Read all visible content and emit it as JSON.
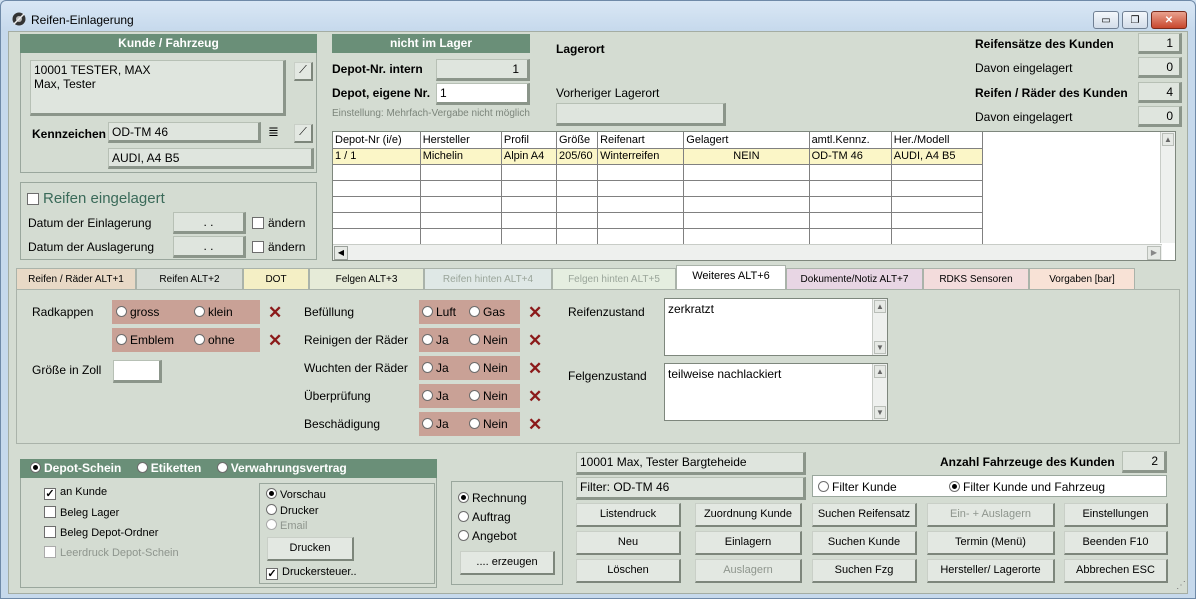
{
  "window": {
    "title": "Reifen-Einlagerung",
    "min_glyph": "▭",
    "max_glyph": "❐",
    "close_glyph": "✕"
  },
  "customer": {
    "header": "Kunde / Fahrzeug",
    "line1": "10001 TESTER, MAX",
    "line2": "Max, Tester",
    "plate_label": "Kennzeichen",
    "plate": "OD-TM 46",
    "vehicle": "AUDI, A4 B5"
  },
  "storage": {
    "header": "nicht im Lager",
    "depot_intern_label": "Depot-Nr. intern",
    "depot_intern": "1",
    "depot_own_label": "Depot, eigene Nr.",
    "depot_own": "1",
    "hint": "Einstellung: Mehrfach-Vergabe nicht möglich",
    "lagerort_label": "Lagerort",
    "prev_lagerort_label": "Vorheriger Lagerort",
    "prev_lagerort": ""
  },
  "stats": {
    "sets_label": "Reifensätze des Kunden",
    "sets": "1",
    "sets_stored_label": "Davon eingelagert",
    "sets_stored": "0",
    "tires_label": "Reifen / Räder des Kunden",
    "tires": "4",
    "tires_stored_label": "Davon eingelagert",
    "tires_stored": "0"
  },
  "stored_box": {
    "title": "Reifen eingelagert",
    "in_label": "Datum der Einlagerung",
    "in_value": ". .",
    "out_label": "Datum der Auslagerung",
    "out_value": ". .",
    "change_label": "ändern"
  },
  "grid": {
    "columns": [
      "Depot-Nr (i/e)",
      "Hersteller",
      "Profil",
      "Größe",
      "Reifenart",
      "Gelagert",
      "amtl.Kennz.",
      "Her./Modell"
    ],
    "rows": [
      [
        "1 / 1",
        "Michelin",
        "Alpin A4",
        "205/60",
        "Winterreifen",
        "NEIN",
        "OD-TM 46",
        "AUDI, A4 B5"
      ]
    ]
  },
  "tabs": [
    {
      "label": "Reifen / Räder ALT+1",
      "color": "#e8d9c6"
    },
    {
      "label": "Reifen ALT+2",
      "color": "#d6dcd5"
    },
    {
      "label": "DOT",
      "color": "#f4efc5"
    },
    {
      "label": "Felgen ALT+3",
      "color": "#e6ebd8"
    },
    {
      "label": "Reifen hinten ALT+4",
      "color": "#dfe8e6"
    },
    {
      "label": "Felgen hinten ALT+5",
      "color": "#e5eee0"
    },
    {
      "label": "Weiteres ALT+6",
      "color": "#ffffff"
    },
    {
      "label": "Dokumente/Notiz ALT+7",
      "color": "#e8d6e4"
    },
    {
      "label": "RDKS Sensoren",
      "color": "#f3dcdc"
    },
    {
      "label": "Vorgaben [bar]",
      "color": "#f8e2d6"
    }
  ],
  "further": {
    "radkappen_label": "Radkappen",
    "gross": "gross",
    "klein": "klein",
    "emblem": "Emblem",
    "ohne": "ohne",
    "groesse_label": "Größe in Zoll",
    "groesse": "",
    "befuellung_label": "Befüllung",
    "luft": "Luft",
    "gas": "Gas",
    "reinigen_label": "Reinigen der Räder",
    "wuchten_label": "Wuchten der Räder",
    "pruefung_label": "Überprüfung",
    "beschaedigung_label": "Beschädigung",
    "ja": "Ja",
    "nein": "Nein",
    "reifenzustand_label": "Reifenzustand",
    "reifenzustand": "zerkratzt",
    "felgenzustand_label": "Felgenzustand",
    "felgenzustand": "teilweise nachlackiert"
  },
  "print": {
    "depot": "Depot-Schein",
    "etiketten": "Etiketten",
    "vertrag": "Verwahrungsvertrag",
    "an_kunde": "an Kunde",
    "beleg_lager": "Beleg Lager",
    "beleg_ordner": "Beleg Depot-Ordner",
    "leerdruck": "Leerdruck Depot-Schein",
    "vorschau": "Vorschau",
    "drucker": "Drucker",
    "email": "Email",
    "drucken": "Drucken",
    "druckersteuer": "Druckersteuer.."
  },
  "doc": {
    "rechnung": "Rechnung",
    "auftrag": "Auftrag",
    "angebot": "Angebot",
    "erzeugen": ".... erzeugen"
  },
  "info": {
    "customer_line": "10001 Max, Tester Bargteheide",
    "filter_line": "Filter: OD-TM 46",
    "vehicles_label": "Anzahl Fahrzeuge des Kunden",
    "vehicles": "2",
    "filter_kunde": "Filter Kunde",
    "filter_kunde_fzg": "Filter Kunde und Fahrzeug"
  },
  "buttons": {
    "listendruck": "Listendruck",
    "zuordnung": "Zuordnung Kunde",
    "suchen_satz": "Suchen Reifensatz",
    "ein_aus": "Ein- + Auslagern",
    "einstellungen": "Einstellungen",
    "neu": "Neu",
    "einlagern": "Einlagern",
    "suchen_kunde": "Suchen Kunde",
    "termin": "Termin (Menü)",
    "beenden": "Beenden F10",
    "loeschen": "Löschen",
    "auslagern": "Auslagern",
    "suchen_fzg": "Suchen Fzg",
    "hersteller": "Hersteller/ Lagerorte",
    "abbrechen": "Abbrechen ESC"
  }
}
